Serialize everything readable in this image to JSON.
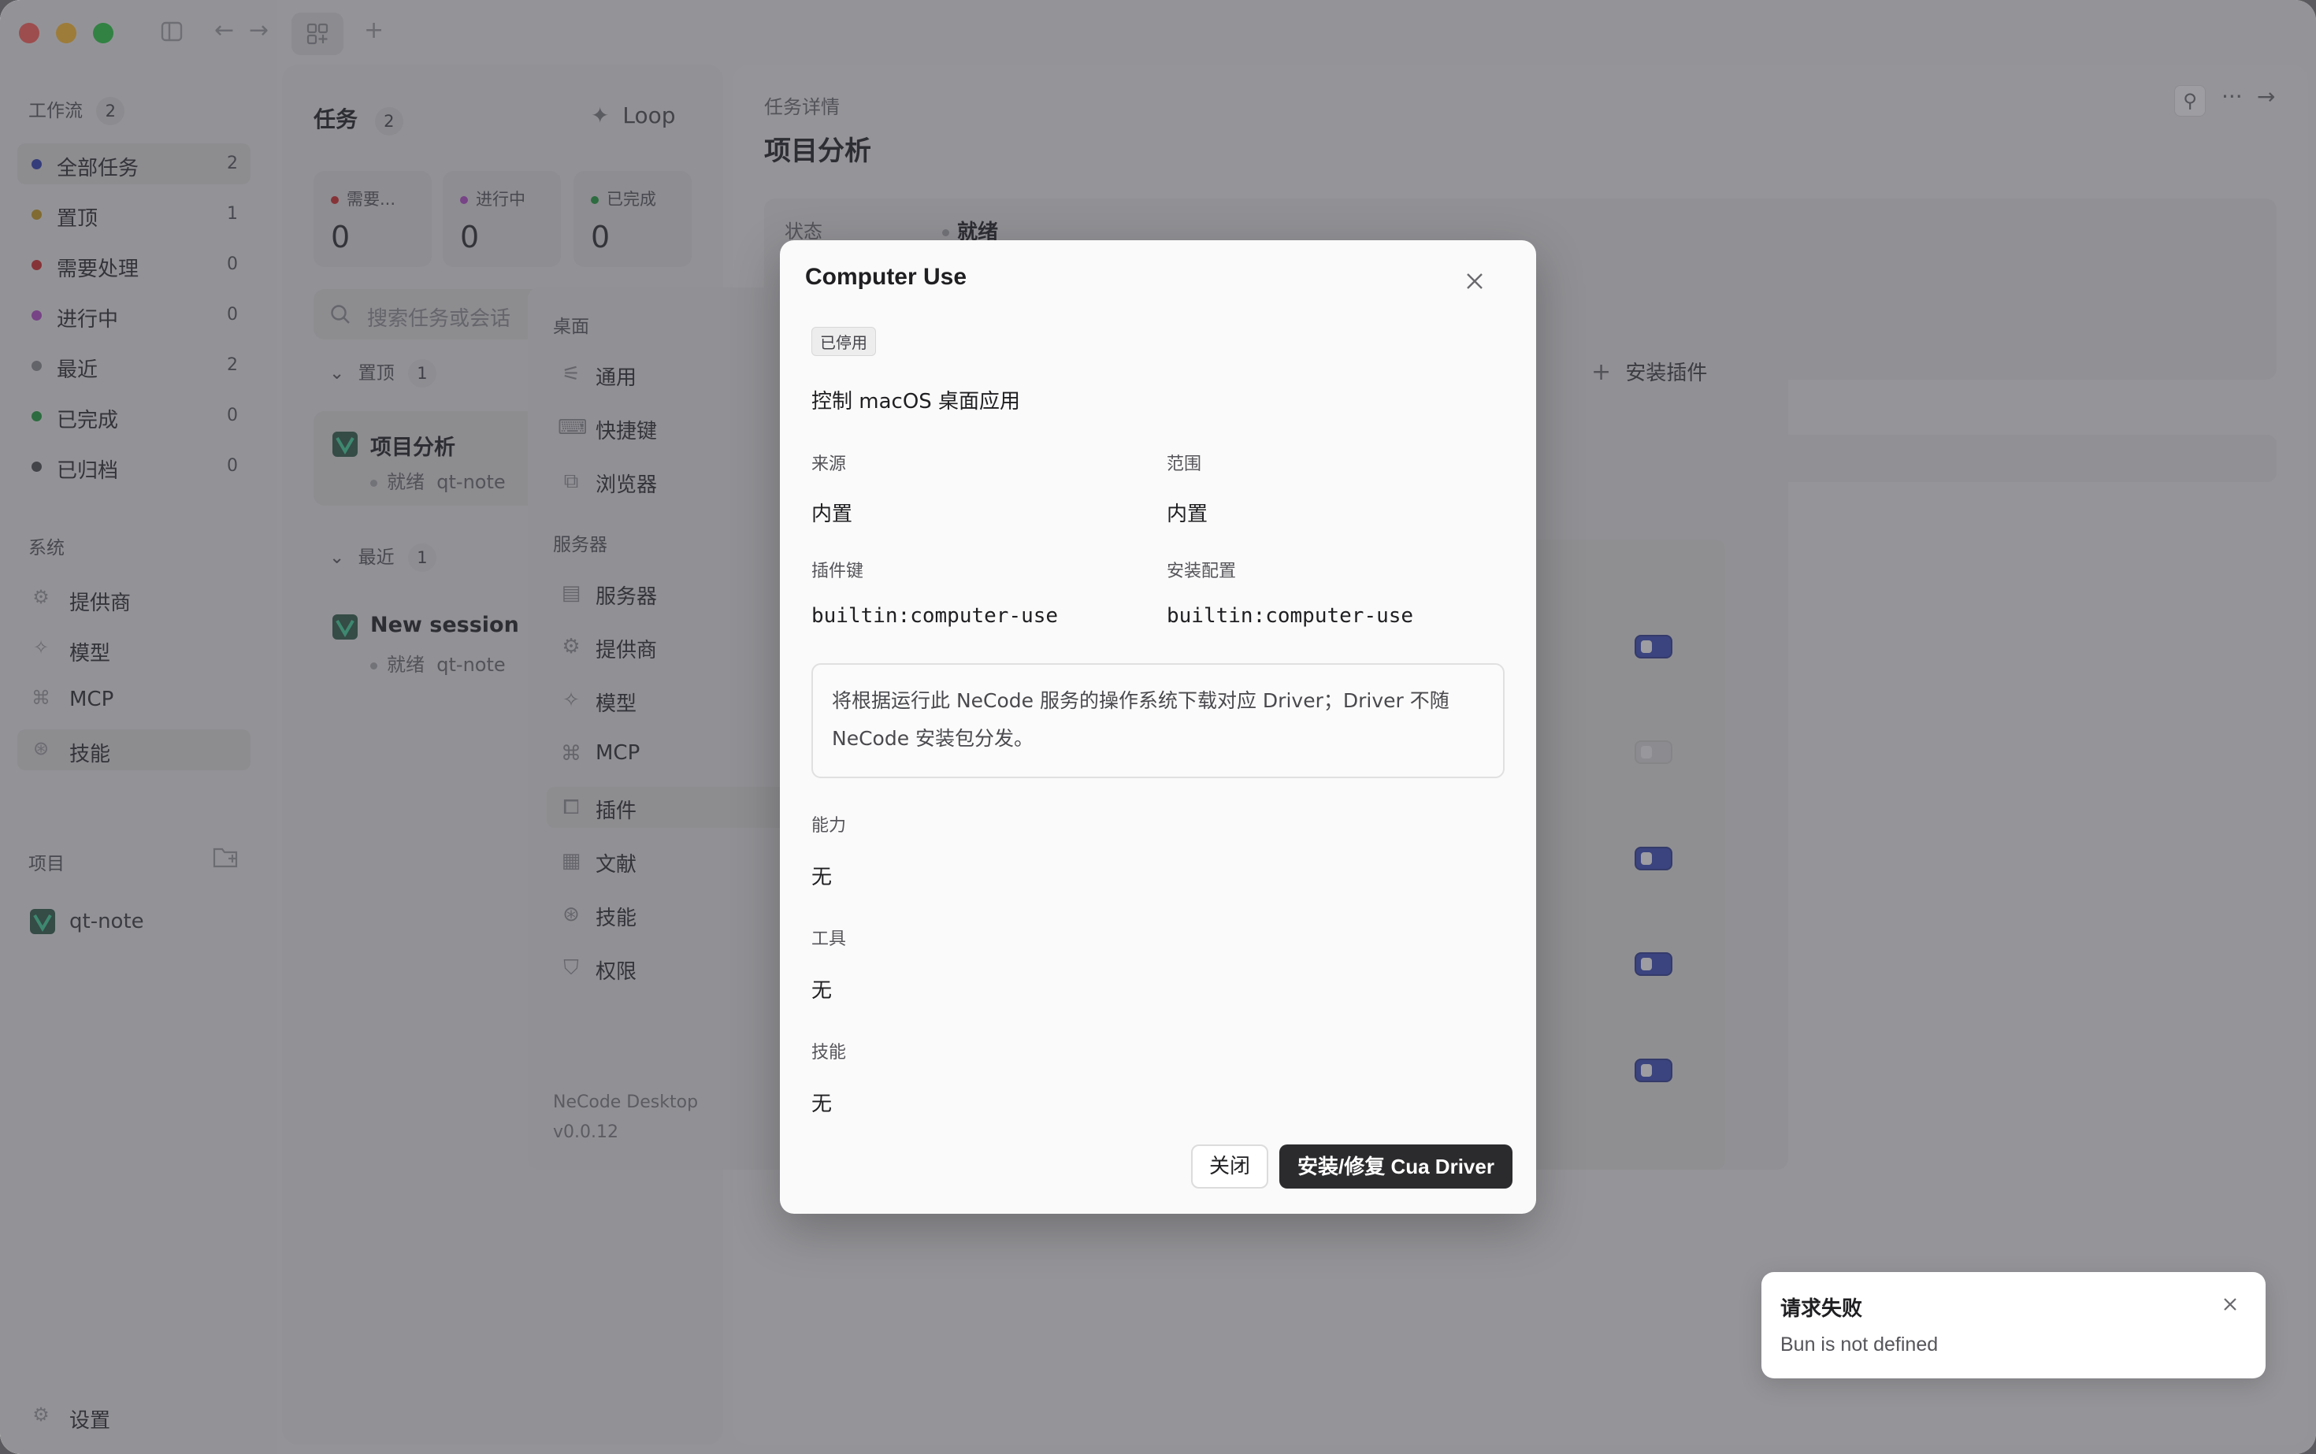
{
  "sidebar": {
    "workflow_label": "工作流",
    "workflow_count": "2",
    "items": [
      {
        "label": "全部任务",
        "count": "2",
        "color": "#2f3fb0"
      },
      {
        "label": "置顶",
        "count": "1",
        "color": "#c79a1e"
      },
      {
        "label": "需要处理",
        "count": "0",
        "color": "#d12b2b"
      },
      {
        "label": "进行中",
        "count": "0",
        "color": "#b24cc7"
      },
      {
        "label": "最近",
        "count": "2",
        "color": "#8a8a8e"
      },
      {
        "label": "已完成",
        "count": "0",
        "color": "#1f9d3a"
      },
      {
        "label": "已归档",
        "count": "0",
        "color": "#4a4a4e"
      }
    ],
    "system_label": "系统",
    "system_items": [
      {
        "label": "提供商",
        "icon": "gear-chip-icon"
      },
      {
        "label": "模型",
        "icon": "sparkle-icon"
      },
      {
        "label": "MCP",
        "icon": "mcp-icon"
      },
      {
        "label": "技能",
        "icon": "skill-icon"
      }
    ],
    "projects_label": "项目",
    "project": "qt-note",
    "settings_label": "设置"
  },
  "tasks": {
    "title": "任务",
    "count": "2",
    "loop_label": "Loop",
    "stats": [
      {
        "label": "需要...",
        "value": "0",
        "color": "#d12b2b"
      },
      {
        "label": "进行中",
        "value": "0",
        "color": "#b24cc7"
      },
      {
        "label": "已完成",
        "value": "0",
        "color": "#1f9d3a"
      }
    ],
    "search_placeholder": "搜索任务或会话",
    "pinned_group": "置顶",
    "pinned_count": "1",
    "recent_group": "最近",
    "recent_count": "1",
    "task1_title": "项目分析",
    "task1_status": "就绪",
    "task1_project": "qt-note",
    "task2_title": "New session",
    "task2_status": "就绪",
    "task2_project": "qt-note"
  },
  "detail": {
    "crumb": "任务详情",
    "title": "项目分析",
    "status_label": "状态",
    "status_value": "就绪"
  },
  "settings": {
    "desktop_label": "桌面",
    "desktop_items": [
      {
        "label": "通用",
        "icon": "sliders-icon"
      },
      {
        "label": "快捷键",
        "icon": "keyboard-icon"
      },
      {
        "label": "浏览器",
        "icon": "browser-icon"
      }
    ],
    "server_label": "服务器",
    "server_items": [
      {
        "label": "服务器",
        "icon": "server-icon"
      },
      {
        "label": "提供商",
        "icon": "chip-icon"
      },
      {
        "label": "模型",
        "icon": "sparkle-icon"
      },
      {
        "label": "MCP",
        "icon": "mcp-icon"
      },
      {
        "label": "插件",
        "icon": "plugin-icon"
      },
      {
        "label": "文献",
        "icon": "archive-icon"
      },
      {
        "label": "技能",
        "icon": "skill-icon"
      },
      {
        "label": "权限",
        "icon": "shield-icon"
      }
    ],
    "install_plugin": "安装插件",
    "app_name": "NeCode Desktop",
    "version": "v0.0.12"
  },
  "modal": {
    "title": "Computer Use",
    "badge": "已停用",
    "description": "控制 macOS 桌面应用",
    "source_label": "来源",
    "source_value": "内置",
    "scope_label": "范围",
    "scope_value": "内置",
    "key_label": "插件键",
    "key_value": "builtin:computer-use",
    "install_label": "安装配置",
    "install_value": "builtin:computer-use",
    "note_line1": "将根据运行此 NeCode 服务的操作系统下载对应 Driver；Driver 不随",
    "note_line2": "NeCode 安装包分发。",
    "capability_label": "能力",
    "capability_value": "无",
    "tools_label": "工具",
    "tools_value": "无",
    "skills_label": "技能",
    "skills_value": "无",
    "close_button": "关闭",
    "primary_button": "安装/修复 Cua Driver"
  },
  "toast": {
    "title": "请求失败",
    "message": "Bun is not defined"
  }
}
